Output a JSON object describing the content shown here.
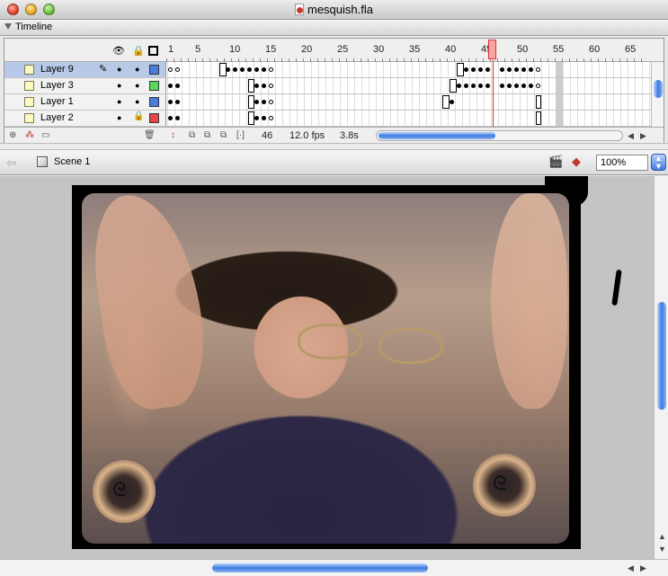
{
  "window": {
    "title": "mesquish.fla"
  },
  "timeline": {
    "label": "Timeline",
    "ruler_numbers": [
      "1",
      "5",
      "10",
      "15",
      "20",
      "25",
      "30",
      "35",
      "40",
      "45",
      "50",
      "55",
      "60",
      "65"
    ],
    "playhead_frame": 46,
    "layers": [
      {
        "name": "Layer 9",
        "color": "#4a7ce0",
        "selected": true,
        "locked": false,
        "editing": true
      },
      {
        "name": "Layer 3",
        "color": "#58d858",
        "selected": false,
        "locked": false,
        "editing": false
      },
      {
        "name": "Layer 1",
        "color": "#4a7ce0",
        "selected": false,
        "locked": false,
        "editing": false
      },
      {
        "name": "Layer 2",
        "color": "#e04848",
        "selected": false,
        "locked": true,
        "editing": false
      }
    ],
    "footer": {
      "current_frame": "46",
      "frame_rate": "12.0 fps",
      "elapsed": "3.8s"
    }
  },
  "editbar": {
    "scene_label": "Scene 1",
    "zoom": "100%"
  },
  "icons": [
    "eye-icon",
    "lock-icon",
    "outline-icon",
    "pencil-icon",
    "insert-layer-icon",
    "motion-guide-icon",
    "insert-folder-icon",
    "trash-icon",
    "onion-skin-icon",
    "edit-scene-icon",
    "edit-symbol-icon",
    "back-arrow-icon",
    "scene-icon"
  ]
}
